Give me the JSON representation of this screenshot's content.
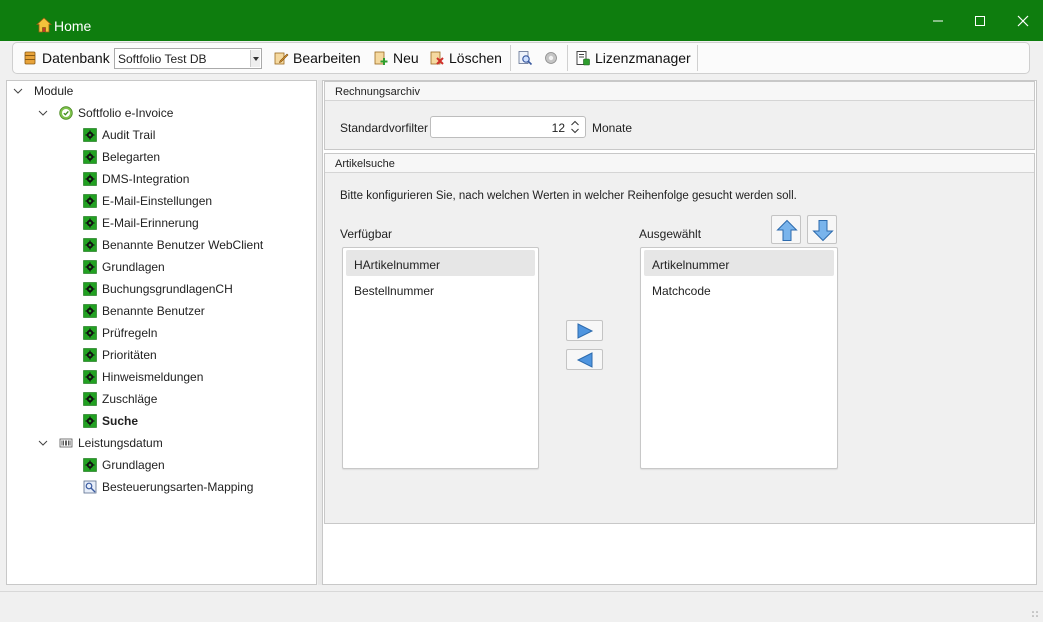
{
  "window": {
    "title": "Home",
    "icon": "home-icon",
    "accent": "#0e7d0e"
  },
  "toolbar": {
    "database_label": "Datenbank",
    "database_value": "Softfolio Test DB",
    "edit_label": "Bearbeiten",
    "new_label": "Neu",
    "delete_label": "Löschen",
    "license_label": "Lizenzmanager"
  },
  "tree": {
    "root": "Module",
    "einvoice": {
      "label": "Softfolio e-Invoice",
      "items": [
        "Audit Trail",
        "Belegarten",
        "DMS-Integration",
        "E-Mail-Einstellungen",
        "E-Mail-Erinnerung",
        "Benannte Benutzer WebClient",
        "Grundlagen",
        "BuchungsgrundlagenCH",
        "Benannte Benutzer",
        "Prüfregeln",
        "Prioritäten",
        "Hinweismeldungen",
        "Zuschläge",
        "Suche"
      ]
    },
    "leistungsdatum": {
      "label": "Leistungsdatum",
      "items": [
        "Grundlagen",
        "Besteuerungsarten-Mapping"
      ]
    }
  },
  "rechnungsarchiv": {
    "header": "Rechnungsarchiv",
    "filter_label": "Standardvorfilter",
    "filter_value": "12",
    "filter_unit": "Monate"
  },
  "artikelsuche": {
    "header": "Artikelsuche",
    "description": "Bitte konfigurieren Sie, nach welchen Werten in welcher Reihenfolge gesucht werden soll.",
    "available_label": "Verfügbar",
    "available_items": [
      "HArtikelnummer",
      "Bestellnummer"
    ],
    "selected_label": "Ausgewählt",
    "selected_items": [
      "Artikelnummer",
      "Matchcode"
    ]
  }
}
